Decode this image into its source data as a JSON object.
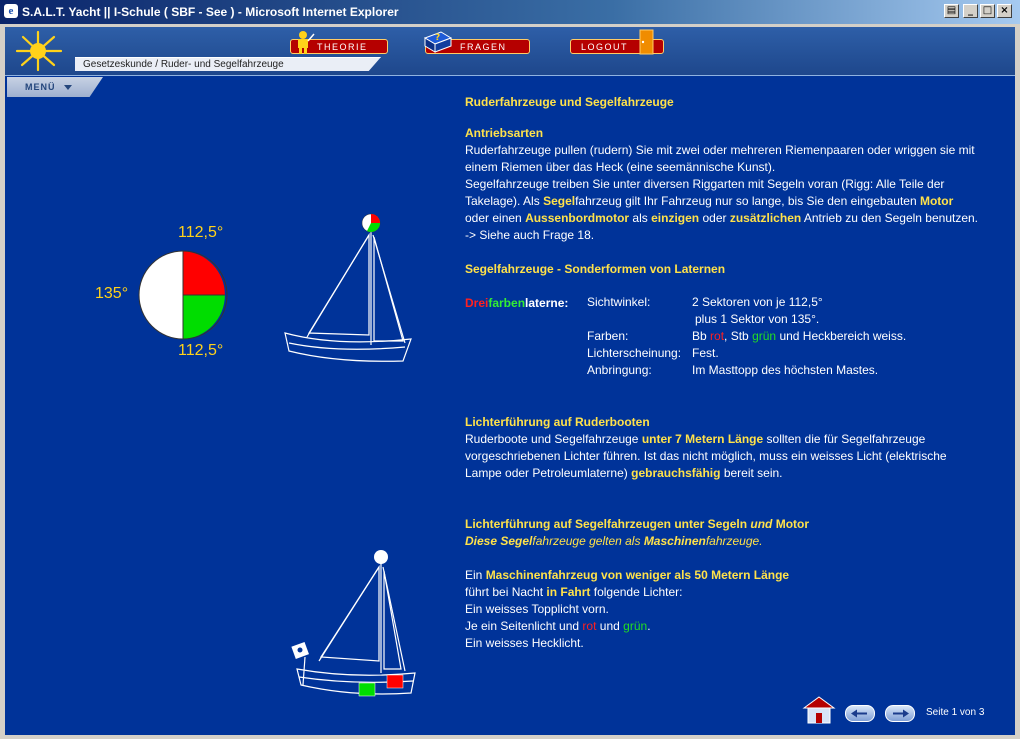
{
  "window": {
    "title": "S.A.L.T. Yacht || I-Schule ( SBF - See ) - Microsoft Internet Explorer",
    "icon": "e"
  },
  "nav": {
    "theorie": "THEORIE",
    "fragen": "FRAGEN",
    "logout": "LOGOUT",
    "breadcrumb": "Gesetzeskunde / Ruder- und Segelfahrzeuge",
    "menu": "MENÜ"
  },
  "sections": {
    "title": "Ruderfahrzeuge und Segelfahrzeuge",
    "antrieb_heading": "Antriebsarten",
    "antrieb_line1": "Ruderfahrzeuge pullen (rudern) Sie mit zwei oder mehreren Riemenpaaren oder wriggen sie mit",
    "antrieb_line2": "einem Riemen über das Heck (eine seemännische Kunst).",
    "antrieb_line3": "Segelfahrzeuge treiben Sie unter diversen Riggarten mit Segeln voran (Rigg: Alle Teile der",
    "antrieb_line4a": "Takelage). Als",
    "antrieb_line4b": "Segel",
    "antrieb_line4c": "fahrzeug gilt Ihr Fahrzeug nur so lange, bis Sie den eingebauten",
    "antrieb_line4d": "Motor",
    "antrieb_line5a": "oder einen",
    "antrieb_line5b": "Aussenbordmotor",
    "antrieb_line5c": "als",
    "antrieb_line5d": "einzigen",
    "antrieb_line5e": "oder",
    "antrieb_line5f": "zusätzlichen",
    "antrieb_line5g": "Antrieb zu den Segeln benutzen.",
    "antrieb_line6": "->  Siehe auch Frage 18.",
    "laternen_heading": "Segelfahrzeuge - Sonderformen von Laternen",
    "dreifarben_a": "Drei",
    "dreifarben_b": "farben",
    "dreifarben_c": "laterne:",
    "sicht_label": "Sichtwinkel:",
    "sicht_value1": "2 Sektoren von je 112,5°",
    "sicht_value2": "plus 1 Sektor von 135°.",
    "farben_label": "Farben:",
    "farben_a": "Bb",
    "farben_rot": "rot",
    "farben_b": ", Stb",
    "farben_gruen": "grün",
    "farben_c": "und Heckbereich  weiss.",
    "licht_label": "Lichterscheinung:",
    "licht_value": "Fest.",
    "anbr_label": "Anbringung:",
    "anbr_value": "Im Masttopp des höchsten Mastes.",
    "ruder_heading": "Lichterführung auf Ruderbooten",
    "ruder_line1a": "Ruderboote und Segelfahrzeuge",
    "ruder_line1b": "unter 7 Metern Länge",
    "ruder_line1c": "sollten die für Segelfahrzeuge",
    "ruder_line2": "vorgeschriebenen Lichter führen. Ist das nicht möglich, muss ein  weisses Licht (elektrische",
    "ruder_line3a": "Lampe oder Petroleumlaterne)",
    "ruder_line3b": "gebrauchsfähig",
    "ruder_line3c": "bereit sein.",
    "motor_heading_a": "Lichterführung auf Segelfahrzeugen unter Segeln",
    "motor_heading_b": "und",
    "motor_heading_c": "Motor",
    "motor_sub_a": "Diese",
    "motor_sub_b": "Segel",
    "motor_sub_c": "fahrzeuge gelten als",
    "motor_sub_d": "Maschinen",
    "motor_sub_e": "fahrzeuge.",
    "motor_line1a": "Ein",
    "motor_line1b": "Maschinenfahrzeug von weniger als 50 Metern Länge",
    "motor_line2a": "führt  bei Nacht",
    "motor_line2b": "in Fahrt",
    "motor_line2c": "folgende Lichter:",
    "motor_line3": "Ein  weisses Topplicht vorn.",
    "motor_line4a": "Je ein Seitenlicht  und",
    "motor_line4b": "rot",
    "motor_line4c": "und",
    "motor_line4d": "grün",
    "motor_line4e": ".",
    "motor_line5": "Ein  weisses Hecklicht."
  },
  "diagram": {
    "angle_top": "112,5°",
    "angle_left": "135°",
    "angle_bottom": "112,5°"
  },
  "pager": {
    "label": "Seite 1 von 3"
  },
  "colors": {
    "background": "#003399",
    "heading": "#ffe24a",
    "red_light": "#ff0000",
    "green_light": "#00dd00"
  }
}
